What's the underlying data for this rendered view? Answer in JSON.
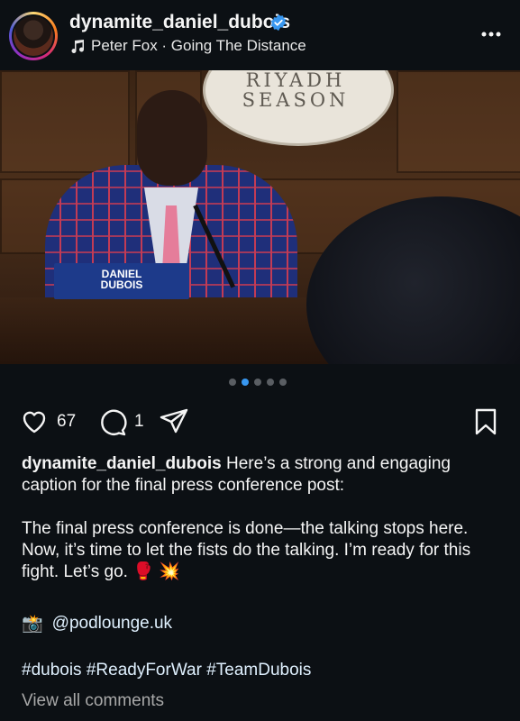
{
  "header": {
    "username": "dynamite_daniel_dubois",
    "verified": true,
    "music": "Peter Fox · Going The Distance",
    "more_icon": "more-horizontal-icon"
  },
  "post_image": {
    "sign_line1": "RIYADH",
    "sign_line2": "SEASON",
    "nameplate_line1": "DANIEL",
    "nameplate_line2": "DUBOIS",
    "sound_icon": "speaker-icon"
  },
  "carousel": {
    "total": 5,
    "active_index": 1,
    "active_color": "#3897f0",
    "inactive_color": "#5a5e63"
  },
  "actions": {
    "likes": "67",
    "comments": "1",
    "icons": [
      "heart-icon",
      "comment-icon",
      "share-icon",
      "bookmark-icon"
    ]
  },
  "caption": {
    "author": "dynamite_daniel_dubois",
    "line1": "Here’s a strong and engaging caption for the final press conference post:",
    "line2": "The final press conference is done—the talking stops here. Now, it’s time to let the fists do the talking. I’m ready for this fight. Let’s go.",
    "emoji": "🥊 💥",
    "credit_emoji": "📸",
    "credit_handle": "@podlounge.uk",
    "hashtags": "#dubois #ReadyForWar #TeamDubois"
  },
  "view_all_comments": "View all comments",
  "colors": {
    "background": "#0c1014",
    "text": "#f5f5f5",
    "link": "#e0f1ff",
    "muted": "#a8a8a8",
    "verified": "#3897f0"
  }
}
